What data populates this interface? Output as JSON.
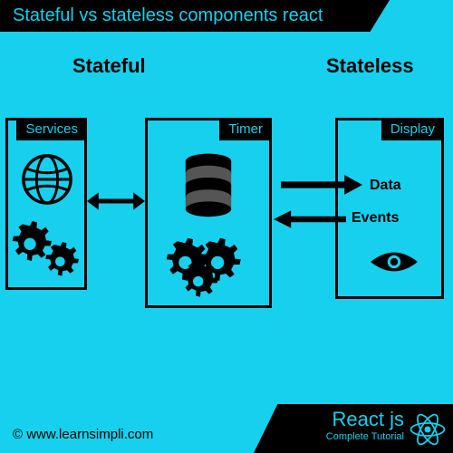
{
  "header": {
    "title": "Stateful vs stateless components react"
  },
  "columns": {
    "left": "Stateful",
    "right": "Stateless"
  },
  "boxes": {
    "services": {
      "label": "Services"
    },
    "timer": {
      "label": "Timer"
    },
    "display": {
      "label": "Display"
    }
  },
  "arrows": {
    "data": "Data",
    "events": "Events"
  },
  "footer": {
    "copyright": "©   www.learnsimpli.com",
    "brand": "React js",
    "subtitle": "Complete Tutorial"
  }
}
